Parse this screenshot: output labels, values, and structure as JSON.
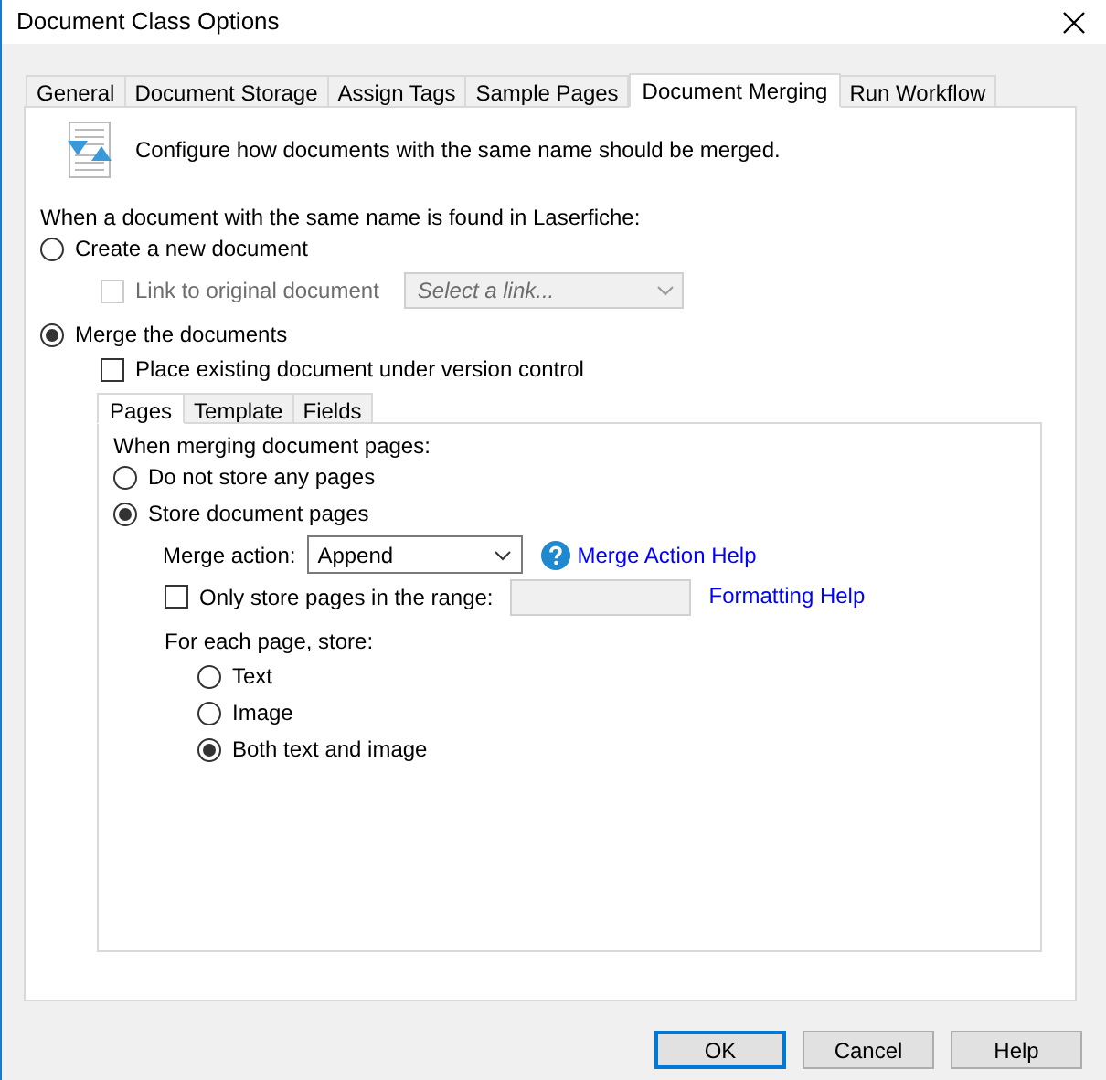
{
  "window": {
    "title": "Document Class Options"
  },
  "tabs": [
    {
      "label": "General",
      "selected": false
    },
    {
      "label": "Document Storage",
      "selected": false
    },
    {
      "label": "Assign Tags",
      "selected": false
    },
    {
      "label": "Sample Pages",
      "selected": false
    },
    {
      "label": "Document Merging",
      "selected": true
    },
    {
      "label": "Run Workflow",
      "selected": false
    }
  ],
  "header": {
    "text": "Configure how documents with the same name should be merged."
  },
  "section_label": "When a document with the same name is found in Laserfiche:",
  "create_option": {
    "label": "Create a new document",
    "selected": false,
    "link_checkbox": {
      "label": "Link to original document",
      "checked": false,
      "disabled": true
    },
    "link_dropdown": {
      "placeholder": "Select a link...",
      "disabled": true
    }
  },
  "merge_option": {
    "label": "Merge the documents",
    "selected": true,
    "version_checkbox": {
      "label": "Place existing document under version control",
      "checked": false,
      "disabled": false
    }
  },
  "inner_tabs": [
    {
      "label": "Pages",
      "selected": true
    },
    {
      "label": "Template",
      "selected": false
    },
    {
      "label": "Fields",
      "selected": false
    }
  ],
  "pages": {
    "label": "When merging document pages:",
    "store_options": [
      {
        "label": "Do not store any pages",
        "selected": false
      },
      {
        "label": "Store document pages",
        "selected": true
      }
    ],
    "merge_action": {
      "label": "Merge action:",
      "value": "Append",
      "help_link": "Merge Action Help"
    },
    "range": {
      "label": "Only store pages in the range:",
      "checked": false,
      "help_link": "Formatting Help"
    },
    "each_page_label": "For each page, store:",
    "each_page_options": [
      {
        "label": "Text",
        "selected": false
      },
      {
        "label": "Image",
        "selected": false
      },
      {
        "label": "Both text and image",
        "selected": true
      }
    ]
  },
  "buttons": [
    {
      "label": "OK",
      "kind": "default"
    },
    {
      "label": "Cancel",
      "kind": "normal"
    },
    {
      "label": "Help",
      "kind": "normal"
    }
  ]
}
